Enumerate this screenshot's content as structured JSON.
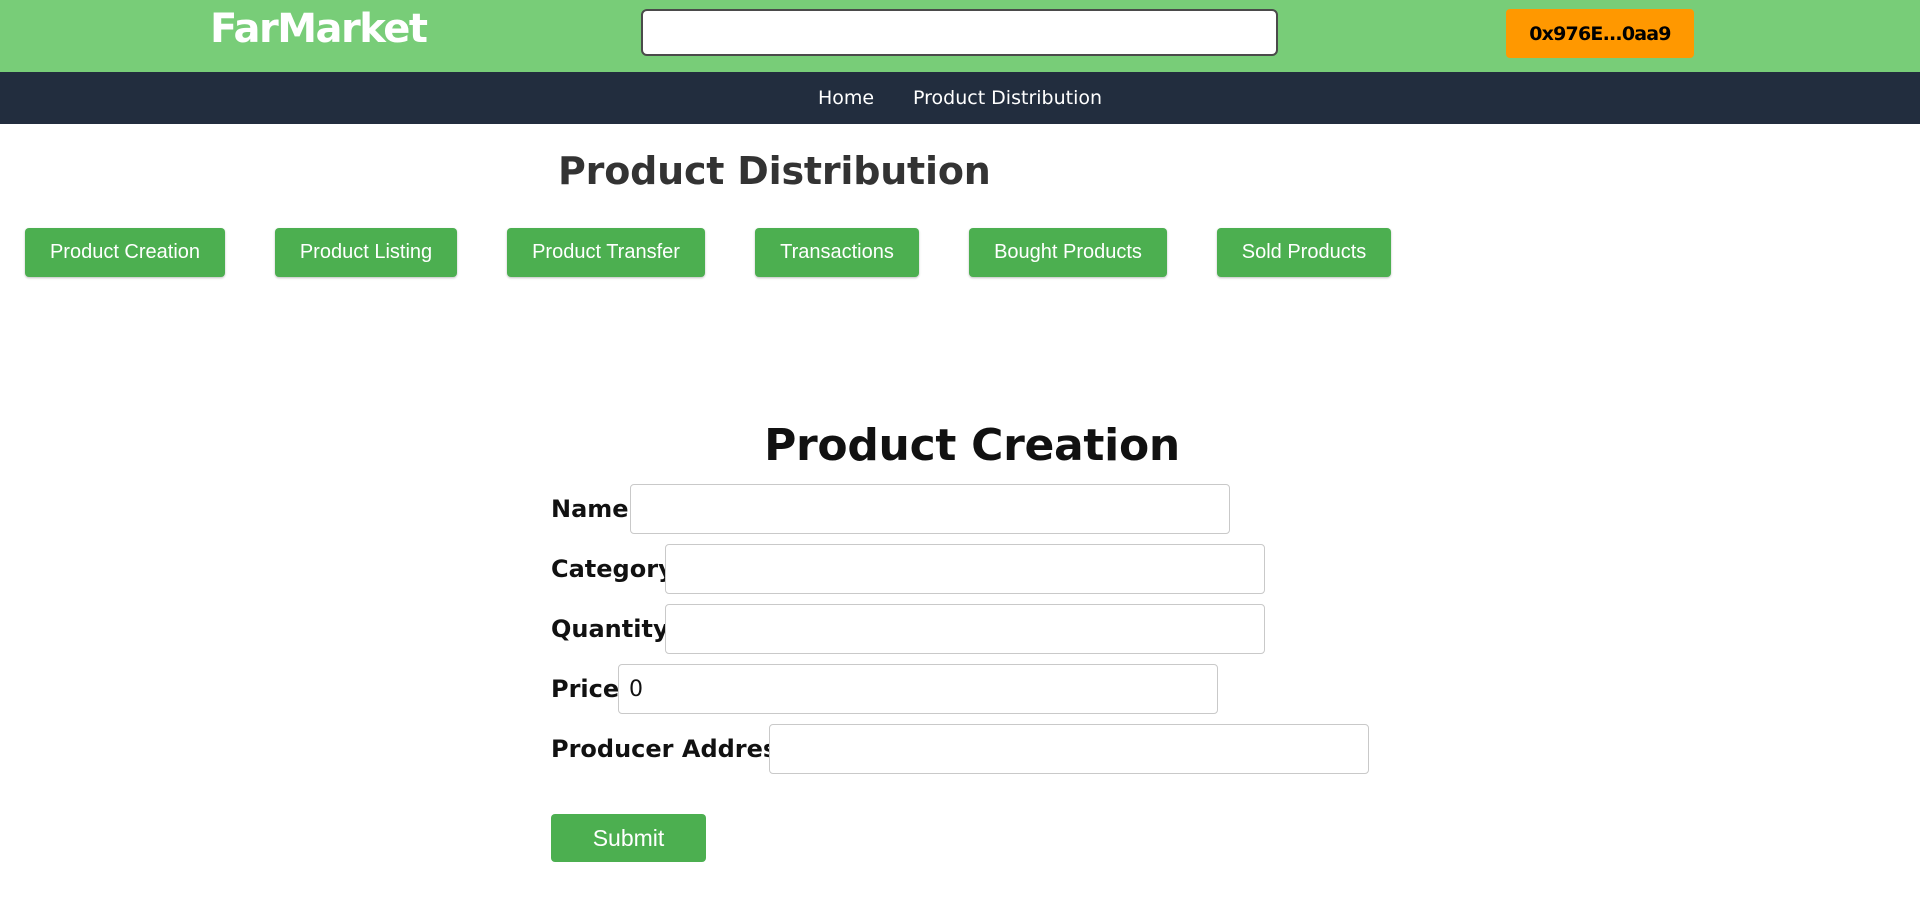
{
  "header": {
    "logo": "FarMarket",
    "search": {
      "value": "",
      "placeholder": ""
    },
    "wallet_address": "0x976E...0aa9"
  },
  "nav": {
    "links": [
      "Home",
      "Product Distribution"
    ]
  },
  "page": {
    "title": "Product Distribution",
    "tabs": [
      "Product Creation",
      "Product Listing",
      "Product Transfer",
      "Transactions",
      "Bought Products",
      "Sold Products"
    ]
  },
  "form": {
    "title": "Product Creation",
    "fields": [
      {
        "label": "Name:",
        "value": ""
      },
      {
        "label": "Category:",
        "value": ""
      },
      {
        "label": "Quantity:",
        "value": ""
      },
      {
        "label": "Price:",
        "value": "0"
      },
      {
        "label": "Producer Address:",
        "value": ""
      }
    ],
    "submit_label": "Submit"
  },
  "colors": {
    "header_bg": "#78cd78",
    "nav_bg": "#222d3e",
    "accent_green": "#4caf50",
    "wallet_orange": "#ff9800"
  }
}
